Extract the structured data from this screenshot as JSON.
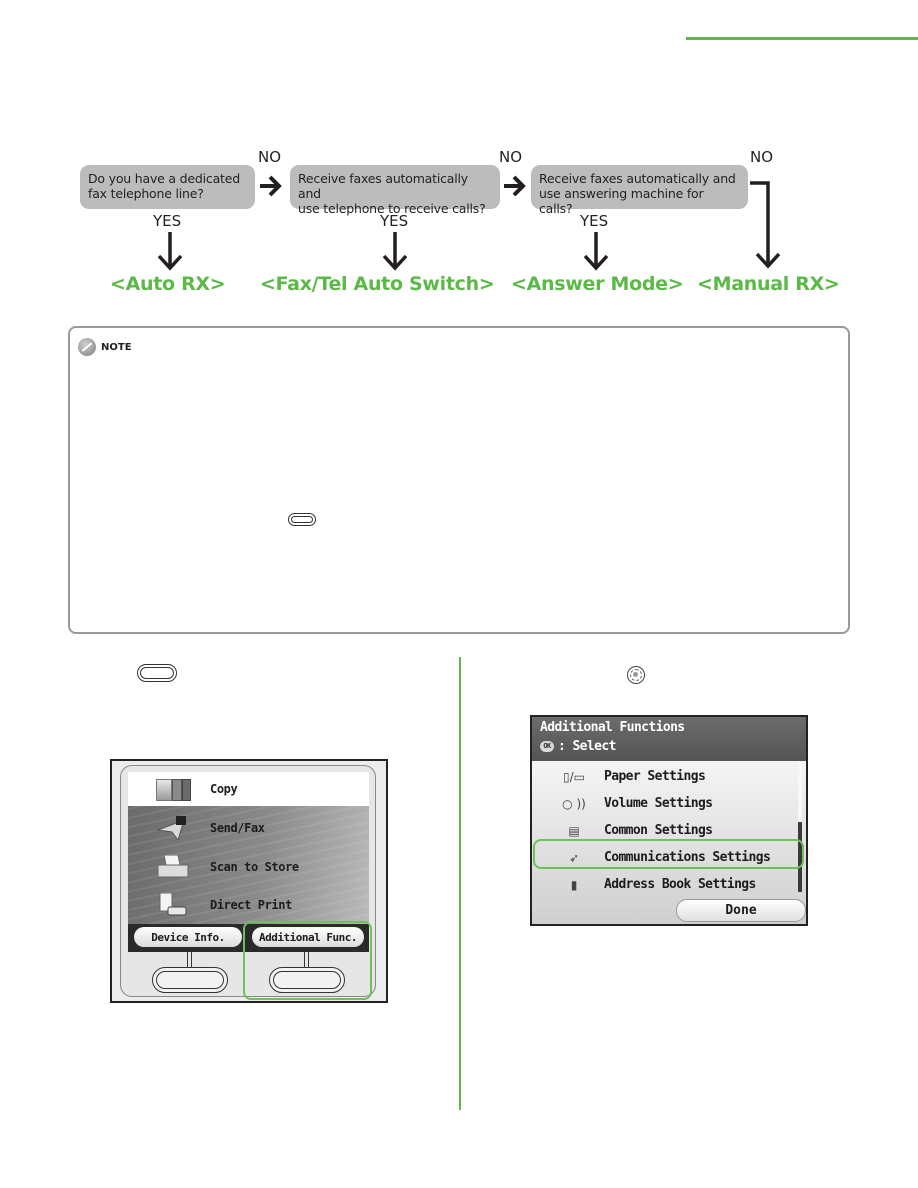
{
  "colors": {
    "accent": "#5bb947",
    "question_box": "#bcbcbc",
    "text": "#231f20"
  },
  "flowchart": {
    "questions": [
      {
        "line1": "Do you have a dedicated",
        "line2": "fax telephone line?"
      },
      {
        "line1": "Receive faxes automatically and",
        "line2": "use telephone to receive calls?"
      },
      {
        "line1": "Receive faxes automatically and",
        "line2": "use answering machine for calls?"
      }
    ],
    "yes_label": "YES",
    "no_label": "NO",
    "results": [
      "<Auto RX>",
      "<Fax/Tel Auto Switch>",
      "<Answer Mode>",
      "<Manual RX>"
    ]
  },
  "note": {
    "label": "NOTE",
    "icon": "pencil-icon",
    "key_icon": "main-menu-key-icon"
  },
  "step_left": {
    "key_icon": "main-menu-key-icon",
    "screen": {
      "menu_items": [
        {
          "label": "Copy",
          "icon": "copy-icon"
        },
        {
          "label": "Send/Fax",
          "icon": "send-fax-icon"
        },
        {
          "label": "Scan to Store",
          "icon": "scan-icon"
        },
        {
          "label": "Direct Print",
          "icon": "direct-print-icon"
        }
      ],
      "soft_buttons": [
        "Device Info.",
        "Additional Func."
      ],
      "highlighted": "Additional Func."
    }
  },
  "step_right": {
    "key_icon": "scroll-wheel-icon",
    "screen": {
      "title": "Additional Functions",
      "ok_badge": "OK",
      "subtitle": ": Select",
      "items": [
        {
          "label": "Paper Settings",
          "icon": "paper-settings-icon",
          "glyph": "▯/▭"
        },
        {
          "label": "Volume Settings",
          "icon": "volume-icon",
          "glyph": "○ ))"
        },
        {
          "label": "Common Settings",
          "icon": "common-settings-icon",
          "glyph": "▤"
        },
        {
          "label": "Communications Settings",
          "icon": "communications-icon",
          "glyph": "➶"
        },
        {
          "label": "Address Book Settings",
          "icon": "address-book-icon",
          "glyph": "▮"
        }
      ],
      "selected": "Communications Settings",
      "done_label": "Done"
    }
  }
}
